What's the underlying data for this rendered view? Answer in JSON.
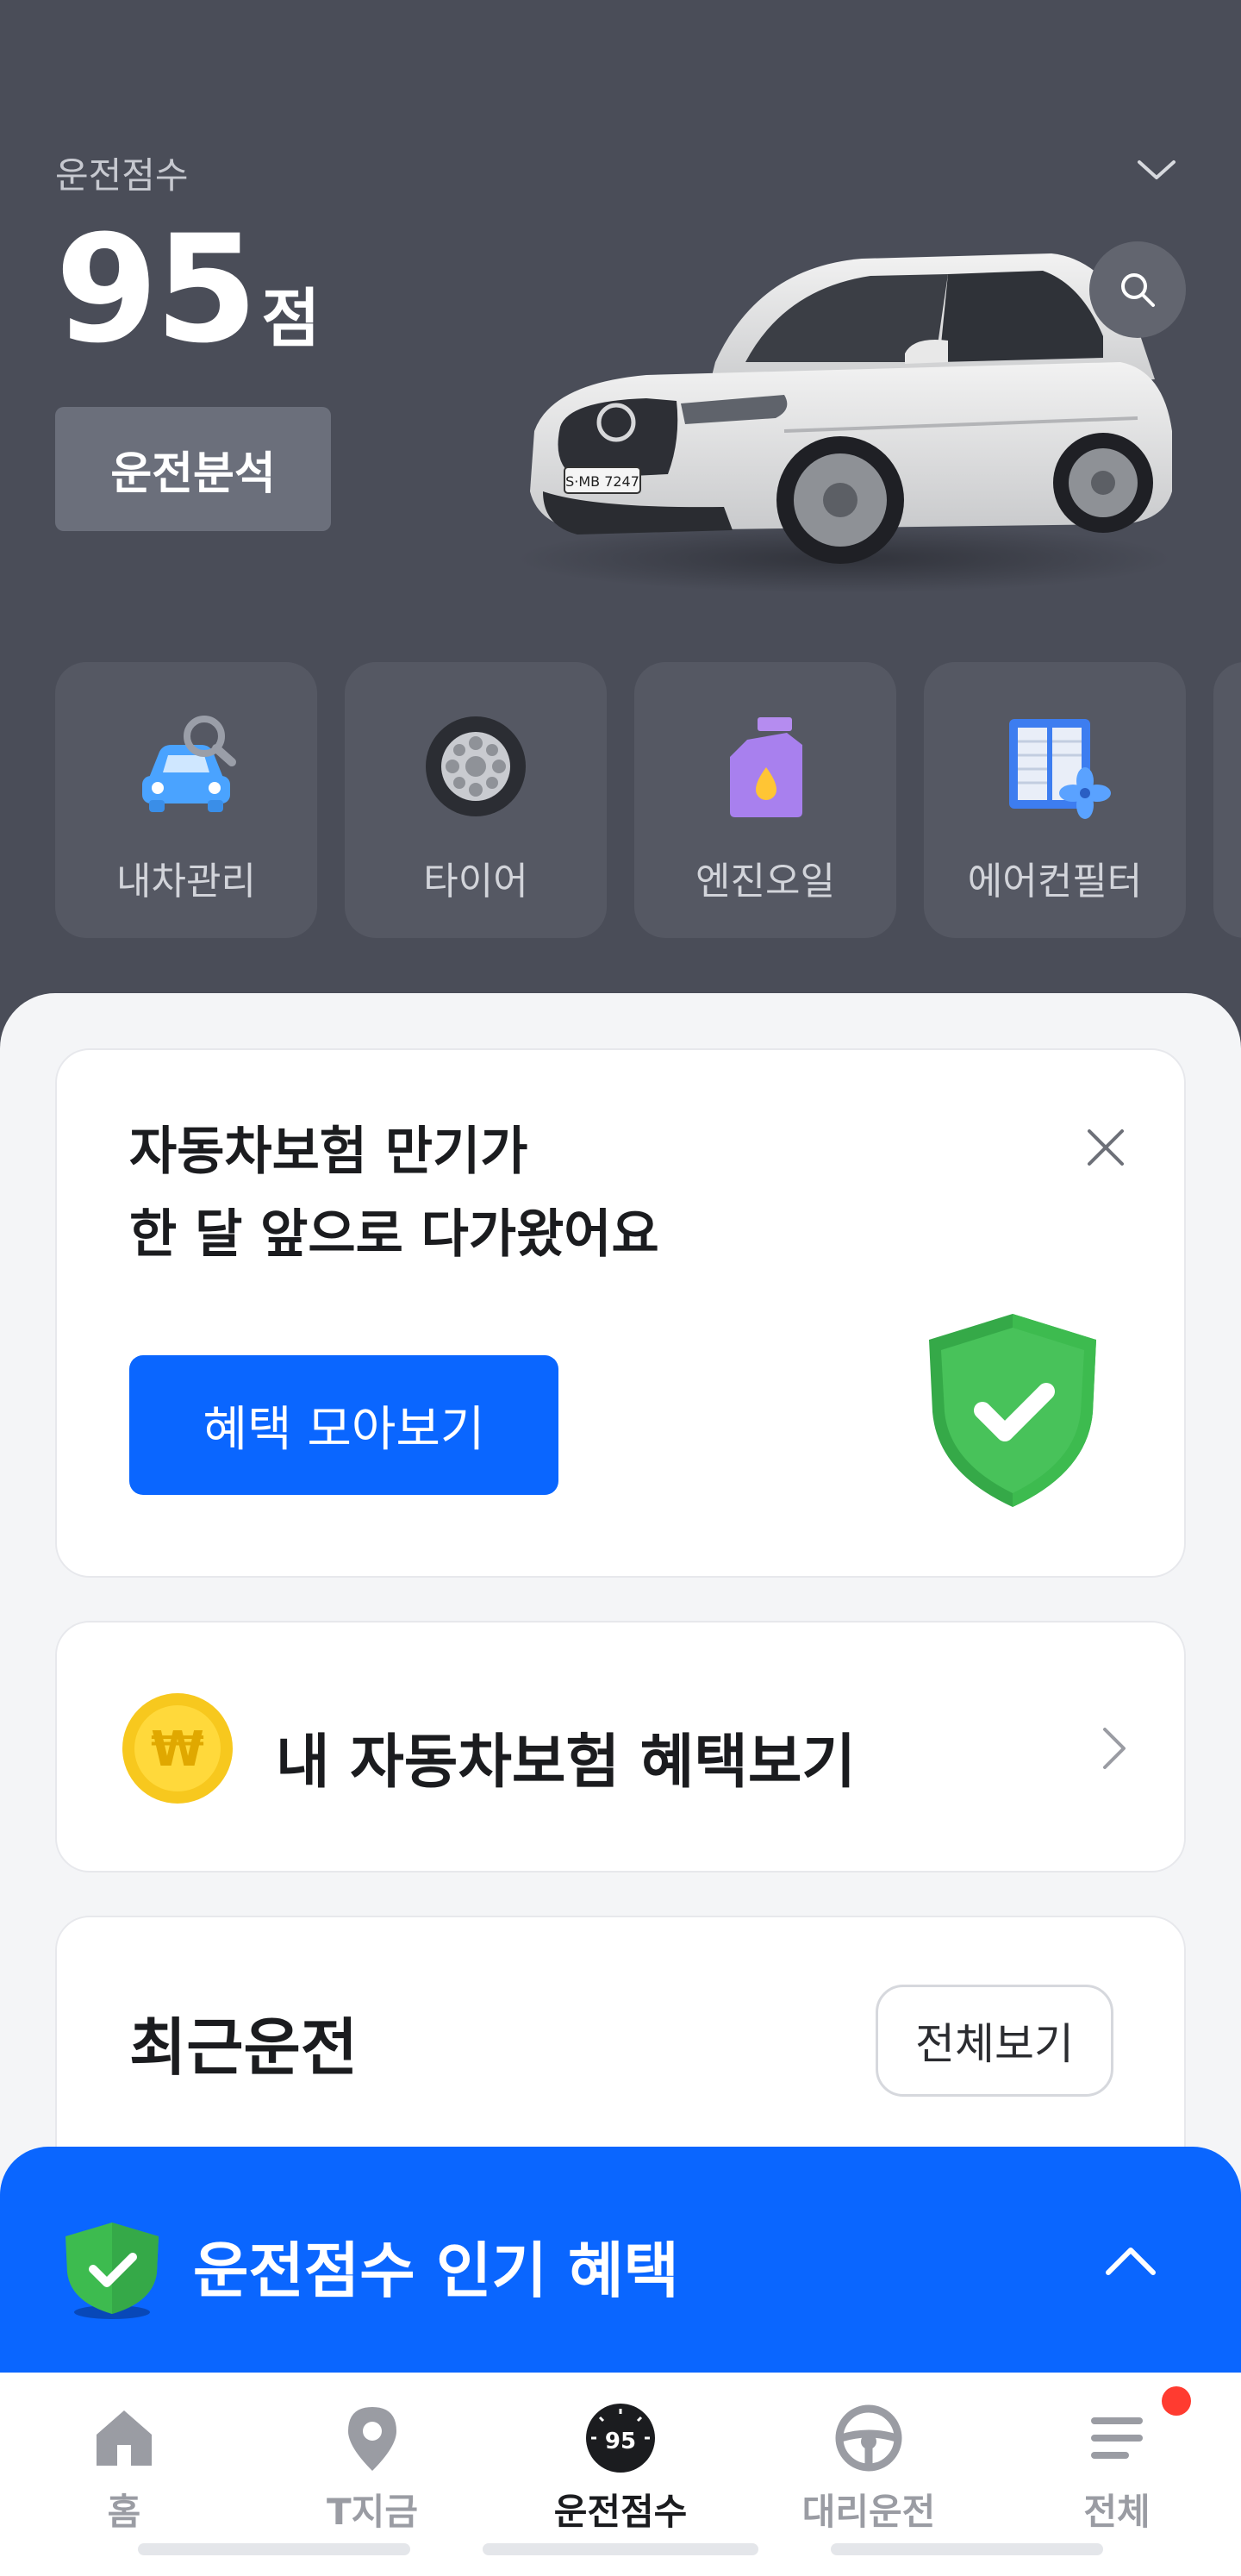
{
  "header": {
    "score_label": "운전점수",
    "score_value": "95",
    "score_unit": "점",
    "analysis_button": "운전분석"
  },
  "tiles": [
    {
      "label": "내차관리",
      "icon": "car-search-icon"
    },
    {
      "label": "타이어",
      "icon": "tire-icon"
    },
    {
      "label": "엔진오일",
      "icon": "engine-oil-icon"
    },
    {
      "label": "에어컨필터",
      "icon": "aircon-filter-icon"
    }
  ],
  "expire_card": {
    "line1": "자동차보험 만기가",
    "line2": "한 달 앞으로 다가왔어요",
    "button": "혜택 모아보기"
  },
  "insurance_card": {
    "label": "내 자동차보험 혜택보기",
    "coin_symbol": "₩"
  },
  "recent_card": {
    "title": "최근운전",
    "view_all": "전체보기"
  },
  "promo": {
    "text": "운전점수 인기 혜택"
  },
  "car_plate": "S·MB 7247",
  "nav": {
    "items": [
      {
        "label": "홈",
        "icon": "home-icon"
      },
      {
        "label": "T지금",
        "icon": "location-pin-icon"
      },
      {
        "label": "운전점수",
        "icon": "driving-score-icon",
        "badge": "95"
      },
      {
        "label": "대리운전",
        "icon": "steering-wheel-icon"
      },
      {
        "label": "전체",
        "icon": "menu-icon"
      }
    ]
  },
  "colors": {
    "header_bg": "#4a4d58",
    "accent_blue": "#0a66ff",
    "shield_green": "#3dbb4f",
    "notification_red": "#ff3b30"
  }
}
